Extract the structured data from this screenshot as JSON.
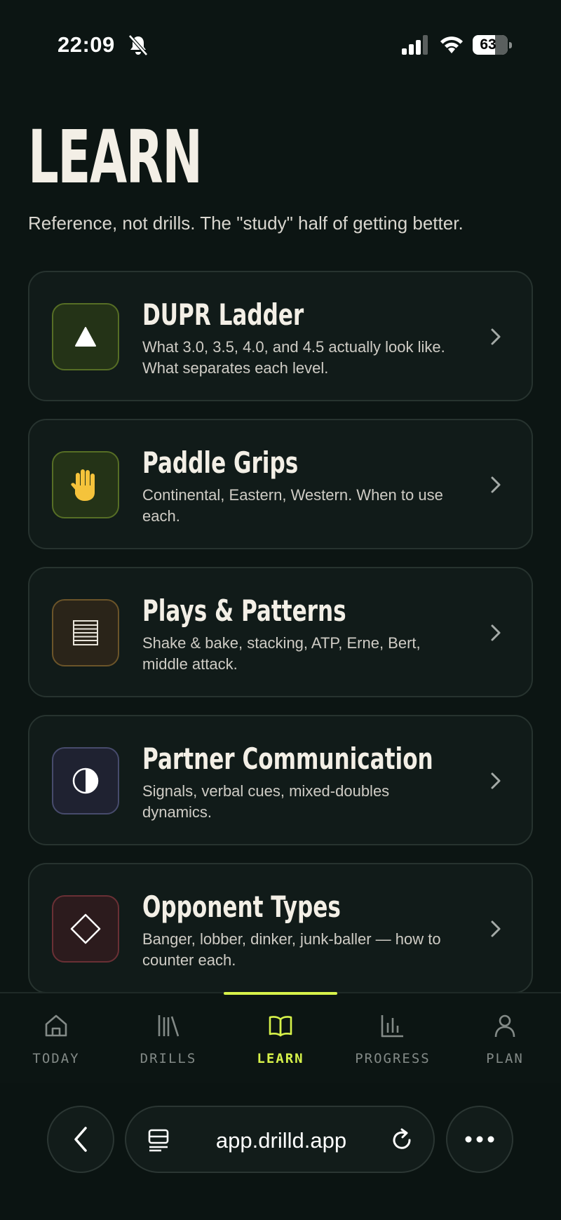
{
  "status": {
    "time": "22:09",
    "battery": "63",
    "icons": [
      "bell-slash-icon",
      "signal-icon",
      "wifi-icon",
      "battery-icon"
    ]
  },
  "header": {
    "title": "LEARN",
    "subtitle": "Reference, not drills. The \"study\" half of getting better."
  },
  "cards": [
    {
      "title": "DUPR Ladder",
      "desc": "What 3.0, 3.5, 4.0, and 4.5 actually look like. What separates each level.",
      "icon": "triangle-icon",
      "icon_bg": "#243317",
      "icon_border": "#566e25"
    },
    {
      "title": "Paddle Grips",
      "desc": "Continental, Eastern, Western. When to use each.",
      "icon": "raised-hand-icon",
      "icon_bg": "#243317",
      "icon_border": "#566e25"
    },
    {
      "title": "Plays & Patterns",
      "desc": "Shake & bake, stacking, ATP, Erne, Bert, middle attack.",
      "icon": "lines-icon",
      "icon_bg": "#2a2419",
      "icon_border": "#6b5429"
    },
    {
      "title": "Partner Communication",
      "desc": "Signals, verbal cues, mixed-doubles dynamics.",
      "icon": "half-circle-icon",
      "icon_bg": "#1f2231",
      "icon_border": "#474b6c"
    },
    {
      "title": "Opponent Types",
      "desc": "Banger, lobber, dinker, junk-baller — how to counter each.",
      "icon": "diamond-icon",
      "icon_bg": "#2c1b1d",
      "icon_border": "#6a3035"
    }
  ],
  "tabs": [
    {
      "label": "TODAY",
      "icon": "home-icon"
    },
    {
      "label": "DRILLS",
      "icon": "library-icon"
    },
    {
      "label": "LEARN",
      "icon": "open-book-icon",
      "active": true
    },
    {
      "label": "PROGRESS",
      "icon": "bar-chart-icon"
    },
    {
      "label": "PLAN",
      "icon": "person-icon"
    }
  ],
  "browser": {
    "url": "app.drilld.app"
  },
  "colors": {
    "background": "#0c1513",
    "card": "#111b19",
    "accent": "#d7f24a",
    "text": "#f3efe6",
    "muted": "#838a87"
  }
}
